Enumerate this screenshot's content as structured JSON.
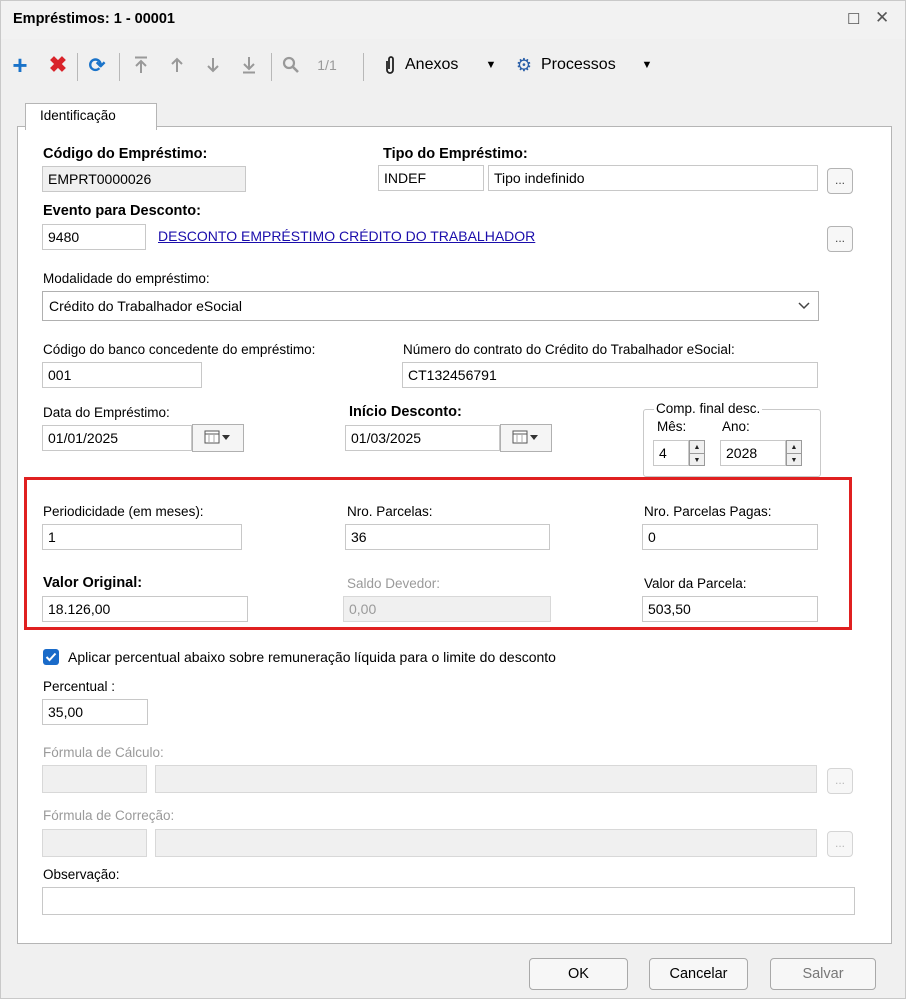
{
  "window": {
    "title": "Empréstimos: 1 - 00001"
  },
  "toolbar": {
    "page_indicator": "1/1",
    "anexos_label": "Anexos",
    "processos_label": "Processos"
  },
  "tab": {
    "label": "Identificação"
  },
  "form": {
    "codigo_label": "Código do Empréstimo:",
    "codigo_value": "EMPRT0000026",
    "tipo_label": "Tipo do Empréstimo:",
    "tipo_code": "INDEF",
    "tipo_desc": "Tipo indefinido",
    "evento_label": "Evento para Desconto:",
    "evento_code": "9480",
    "evento_desc": "DESCONTO EMPRÉSTIMO CRÉDITO DO TRABALHADOR",
    "modalidade_label": "Modalidade do empréstimo:",
    "modalidade_value": "Crédito do Trabalhador eSocial",
    "banco_label": "Código do banco concedente do empréstimo:",
    "banco_value": "001",
    "contrato_label": "Número do contrato do Crédito do Trabalhador eSocial:",
    "contrato_value": "CT132456791",
    "data_label": "Data do Empréstimo:",
    "data_value": "01/01/2025",
    "inicio_label": "Início Desconto:",
    "inicio_value": "01/03/2025",
    "comp_label": "Comp. final desc.",
    "mes_label": "Mês:",
    "mes_value": "4",
    "ano_label": "Ano:",
    "ano_value": "2028",
    "periodicidade_label": "Periodicidade (em meses):",
    "periodicidade_value": "1",
    "parcelas_label": "Nro. Parcelas:",
    "parcelas_value": "36",
    "pagas_label": "Nro. Parcelas Pagas:",
    "pagas_value": "0",
    "valor_original_label": "Valor Original:",
    "valor_original_value": "18.126,00",
    "saldo_label": "Saldo Devedor:",
    "saldo_value": "0,00",
    "valor_parcela_label": "Valor da Parcela:",
    "valor_parcela_value": "503,50",
    "aplicar_label": "Aplicar percentual abaixo sobre remuneração líquida para o limite do desconto",
    "aplicar_checked": true,
    "percentual_label": "Percentual :",
    "percentual_value": "35,00",
    "formula_calculo_label": "Fórmula de Cálculo:",
    "formula_correcao_label": "Fórmula de Correção:",
    "observacao_label": "Observação:"
  },
  "buttons": {
    "ok": "OK",
    "cancelar": "Cancelar",
    "salvar": "Salvar"
  },
  "colors": {
    "highlight_border": "#e02020",
    "link": "#1a0dab",
    "checkbox": "#1a6bc9"
  }
}
